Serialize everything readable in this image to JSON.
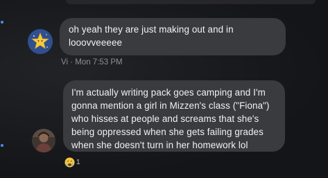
{
  "messages": [
    {
      "sender_avatar": "star-avatar",
      "lines": [
        "oh yeah they are just making out and in",
        "looovveeeee"
      ],
      "meta": "Vi · Mon 7:53 PM"
    },
    {
      "sender_avatar": "photo-avatar",
      "lines": [
        "I'm actually writing pack goes camping and I'm",
        "gonna mention a girl in Mizzen's class (\"Fiona\")",
        "who hisses at people and screams that she's",
        "being oppressed when she gets failing grades",
        "when she doesn't turn in her homework lol"
      ],
      "reaction": {
        "icon": "crying-face-icon",
        "count": "1"
      }
    }
  ],
  "colors": {
    "background": "#16171a",
    "bubble": "#3a3b3f",
    "text": "#f2f2f2",
    "meta": "#8e9096",
    "accent": "#4c8fe8"
  }
}
